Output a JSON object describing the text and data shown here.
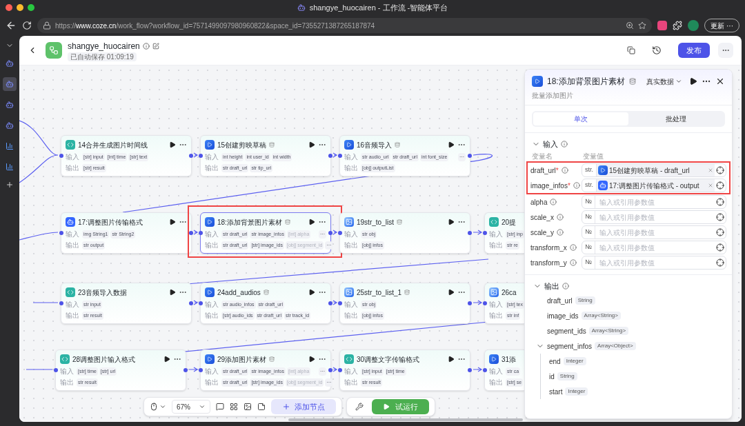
{
  "browser": {
    "title": "shangye_huocairen - 工作流 -智能体平台",
    "url_prefix": "https://",
    "url_host": "www.coze.cn",
    "url_rest": "/work_flow?workflow_id=7571499097980960822&space_id=7355271387265187874",
    "update_label": "更新",
    "update_more": "···"
  },
  "sidebar": {
    "items": [
      {
        "kind": "bot",
        "selected": false
      },
      {
        "kind": "bot",
        "selected": true
      },
      {
        "kind": "bot",
        "selected": false
      },
      {
        "kind": "bot",
        "selected": false
      },
      {
        "kind": "chart",
        "selected": false
      },
      {
        "kind": "chart",
        "selected": false
      }
    ]
  },
  "header": {
    "name": "shangye_huocairen",
    "saved": "已自动保存 01:09:19",
    "publish": "发布"
  },
  "canvas": {
    "rows": [
      [
        {
          "title": "14合并生成图片时间线",
          "kind": "code",
          "badge": false,
          "highlighted": false,
          "in_label": "输入",
          "out_label": "输出",
          "inputs": [
            {
              "type": "[str]",
              "name": "input"
            },
            {
              "type": "[int]",
              "name": "time"
            },
            {
              "type": "[str]",
              "name": "text"
            }
          ],
          "outputs": [
            {
              "type": "[str]",
              "name": "result"
            }
          ]
        },
        {
          "title": "15创建剪映草稿",
          "kind": "plugin",
          "badge": true,
          "highlighted": false,
          "in_label": "输入",
          "out_label": "输出",
          "inputs": [
            {
              "type": "int",
              "name": "height"
            },
            {
              "type": "int",
              "name": "user_id"
            },
            {
              "type": "int",
              "name": "width"
            }
          ],
          "outputs": [
            {
              "type": "str",
              "name": "draft_url"
            },
            {
              "type": "str",
              "name": "tip_url"
            }
          ]
        },
        {
          "title": "16音频导入",
          "kind": "plugin",
          "badge": true,
          "highlighted": false,
          "in_label": "输入",
          "out_label": "输出",
          "inputs": [
            {
              "type": "str",
              "name": "audio_url"
            },
            {
              "type": "str",
              "name": "draft_url"
            },
            {
              "type": "int",
              "name": "font_size"
            }
          ],
          "inputs_more": "···",
          "outputs": [
            {
              "type": "[obj]",
              "name": "outputList"
            }
          ]
        }
      ],
      [
        {
          "title": "17:调整图片传输格式",
          "kind": "bot",
          "badge": false,
          "highlighted": false,
          "in_label": "输入",
          "out_label": "输出",
          "inputs": [
            {
              "type": "img",
              "name": "String1"
            },
            {
              "type": "str",
              "name": "String2"
            }
          ],
          "outputs": [
            {
              "type": "str",
              "name": "output"
            }
          ]
        },
        {
          "title": "18:添加背景图片素材",
          "kind": "plugin",
          "badge": true,
          "highlighted": true,
          "in_label": "输入",
          "out_label": "输出",
          "inputs": [
            {
              "type": "str",
              "name": "draft_url"
            },
            {
              "type": "str",
              "name": "image_infos"
            },
            {
              "type": "[int]",
              "name": "alpha",
              "faded": true
            }
          ],
          "inputs_more": "···",
          "outputs": [
            {
              "type": "str",
              "name": "draft_url"
            },
            {
              "type": "[str]",
              "name": "image_ids"
            },
            {
              "type": "[obj]",
              "name": "segment_id",
              "faded": true
            }
          ],
          "outputs_more": "···"
        },
        {
          "title": "19str_to_list",
          "kind": "image",
          "badge": true,
          "highlighted": false,
          "in_label": "输入",
          "out_label": "输出",
          "inputs": [
            {
              "type": "str",
              "name": "obj"
            }
          ],
          "outputs": [
            {
              "type": "[obj]",
              "name": "infos"
            }
          ]
        },
        {
          "title": "20提",
          "kind": "code",
          "badge": false,
          "highlighted": false,
          "in_label": "输入",
          "out_label": "输出",
          "inputs": [
            {
              "type": "[str]",
              "name": "inp"
            }
          ],
          "outputs": [
            {
              "type": "str",
              "name": "re"
            }
          ]
        }
      ],
      [
        {
          "title": "23音频导入数据",
          "kind": "code",
          "badge": false,
          "highlighted": false,
          "in_label": "输入",
          "out_label": "输出",
          "inputs": [
            {
              "type": "str",
              "name": "input"
            }
          ],
          "outputs": [
            {
              "type": "str",
              "name": "result"
            }
          ]
        },
        {
          "title": "24add_audios",
          "kind": "plugin",
          "badge": true,
          "highlighted": false,
          "in_label": "输入",
          "out_label": "输出",
          "inputs": [
            {
              "type": "str",
              "name": "audio_infos"
            },
            {
              "type": "str",
              "name": "draft_url"
            }
          ],
          "outputs": [
            {
              "type": "[str]",
              "name": "audio_ids"
            },
            {
              "type": "str",
              "name": "draft_url"
            },
            {
              "type": "str",
              "name": "track_id"
            }
          ]
        },
        {
          "title": "25str_to_list_1",
          "kind": "image",
          "badge": true,
          "highlighted": false,
          "in_label": "输入",
          "out_label": "输出",
          "inputs": [
            {
              "type": "str",
              "name": "obj"
            }
          ],
          "outputs": [
            {
              "type": "[obj]",
              "name": "infos"
            }
          ]
        },
        {
          "title": "26ca",
          "kind": "image",
          "badge": false,
          "highlighted": false,
          "in_label": "输入",
          "out_label": "输出",
          "inputs": [
            {
              "type": "[str]",
              "name": "tex"
            }
          ],
          "outputs": [
            {
              "type": "str",
              "name": "inf"
            }
          ]
        }
      ],
      [
        {
          "title": "28调整图片输入格式",
          "kind": "code",
          "badge": false,
          "highlighted": false,
          "in_label": "输入",
          "out_label": "输出",
          "inputs": [
            {
              "type": "[str]",
              "name": "time"
            },
            {
              "type": "[str]",
              "name": "url"
            }
          ],
          "outputs": [
            {
              "type": "str",
              "name": "result"
            }
          ]
        },
        {
          "title": "29添加图片素材",
          "kind": "plugin",
          "badge": true,
          "highlighted": false,
          "in_label": "输入",
          "out_label": "输出",
          "inputs": [
            {
              "type": "str",
              "name": "draft_url"
            },
            {
              "type": "str",
              "name": "image_infos"
            },
            {
              "type": "[int]",
              "name": "alpha",
              "faded": true
            }
          ],
          "inputs_more": "···",
          "outputs": [
            {
              "type": "str",
              "name": "draft_url"
            },
            {
              "type": "[str]",
              "name": "image_ids"
            },
            {
              "type": "[obj]",
              "name": "segment_id",
              "faded": true
            }
          ],
          "outputs_more": "···"
        },
        {
          "title": "30调整文字传输格式",
          "kind": "code",
          "badge": false,
          "highlighted": false,
          "in_label": "输入",
          "out_label": "输出",
          "inputs": [
            {
              "type": "[str]",
              "name": "input"
            },
            {
              "type": "[str]",
              "name": "time"
            }
          ],
          "outputs": [
            {
              "type": "str",
              "name": "result"
            }
          ]
        },
        {
          "title": "31添",
          "kind": "plugin",
          "badge": false,
          "highlighted": false,
          "in_label": "输入",
          "out_label": "输出",
          "inputs": [
            {
              "type": "str",
              "name": "ca"
            }
          ],
          "outputs": [
            {
              "type": "[str]",
              "name": "se"
            }
          ]
        }
      ]
    ]
  },
  "panel": {
    "title": "18:添加背景图片素材",
    "data_mode": "真实数据",
    "subtitle": "批量添加图片",
    "tabs": [
      {
        "label": "单次",
        "selected": true
      },
      {
        "label": "批处理",
        "selected": false
      }
    ],
    "inputs_title": "输入",
    "col_name": "变量名",
    "col_value": "变量值",
    "inputs": [
      {
        "name": "draft_url",
        "required_mark": "*",
        "highlighted": true,
        "type": "str.",
        "ref": {
          "text": "15创建剪映草稿 - draft_url",
          "kind": "plugin"
        }
      },
      {
        "name": "image_infos",
        "required_mark": "*",
        "highlighted": true,
        "type": "str.",
        "ref": {
          "text": "17:调整图片传输格式 - output",
          "kind": "bot"
        }
      },
      {
        "name": "alpha",
        "highlighted": false,
        "type": "№",
        "placeholder": "输入或引用参数值"
      },
      {
        "name": "scale_x",
        "highlighted": false,
        "type": "№",
        "placeholder": "输入或引用参数值"
      },
      {
        "name": "scale_y",
        "highlighted": false,
        "type": "№",
        "placeholder": "输入或引用参数值"
      },
      {
        "name": "transform_x",
        "highlighted": false,
        "type": "№",
        "placeholder": "输入或引用参数值"
      },
      {
        "name": "transform_y",
        "highlighted": false,
        "type": "№",
        "placeholder": "输入或引用参数值"
      }
    ],
    "outputs_title": "输出",
    "outputs": [
      {
        "name": "draft_url",
        "type": "String"
      },
      {
        "name": "image_ids",
        "type": "Array<String>"
      },
      {
        "name": "segment_ids",
        "type": "Array<String>"
      },
      {
        "name": "segment_infos",
        "type": "Array<Object>",
        "expanded": true,
        "children": [
          {
            "name": "end",
            "type": "Integer"
          },
          {
            "name": "id",
            "type": "String"
          },
          {
            "name": "start",
            "type": "Integer"
          }
        ]
      }
    ]
  },
  "toolbar": {
    "zoom": "67%",
    "add_node": "添加节点",
    "test_run": "试运行"
  }
}
